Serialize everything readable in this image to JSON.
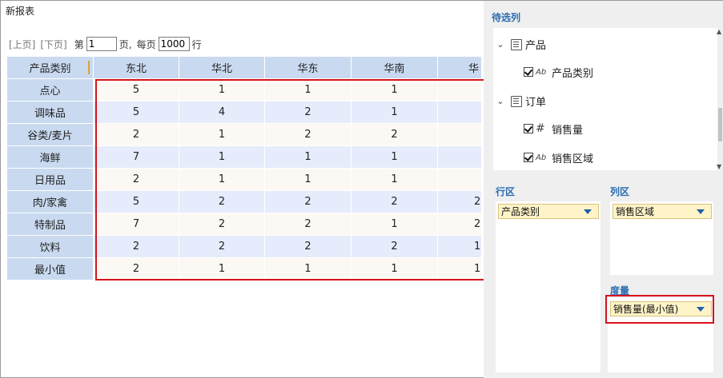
{
  "report": {
    "title": "新报表",
    "pager": {
      "prev": "[上页]",
      "next": "[下页]",
      "page_prefix": "第",
      "page_value": "1",
      "page_suffix": "页,",
      "size_prefix": "每页",
      "size_value": "1000",
      "size_suffix": "行"
    },
    "corner_header": "产品类别",
    "columns": [
      "东北",
      "华北",
      "华东",
      "华南",
      "华"
    ],
    "rows": [
      {
        "label": "点心",
        "values": [
          "5",
          "1",
          "1",
          "1",
          ""
        ]
      },
      {
        "label": "调味品",
        "values": [
          "5",
          "4",
          "2",
          "1",
          ""
        ]
      },
      {
        "label": "谷类/麦片",
        "values": [
          "2",
          "1",
          "2",
          "2",
          ""
        ]
      },
      {
        "label": "海鲜",
        "values": [
          "7",
          "1",
          "1",
          "1",
          ""
        ]
      },
      {
        "label": "日用品",
        "values": [
          "2",
          "1",
          "1",
          "1",
          ""
        ]
      },
      {
        "label": "肉/家禽",
        "values": [
          "5",
          "2",
          "2",
          "2",
          "2"
        ]
      },
      {
        "label": "特制品",
        "values": [
          "7",
          "2",
          "2",
          "1",
          "2"
        ]
      },
      {
        "label": "饮料",
        "values": [
          "2",
          "2",
          "2",
          "2",
          "1"
        ]
      },
      {
        "label": "最小值",
        "values": [
          "2",
          "1",
          "1",
          "1",
          "1"
        ]
      }
    ]
  },
  "panel": {
    "title": "待选列",
    "tree": {
      "group1": "产品",
      "field1": "产品类别",
      "field1_icon": "Ab",
      "group2": "订单",
      "field2": "销售量",
      "field2_icon": "#",
      "field3": "销售区域",
      "field3_icon": "Ab"
    },
    "row_zone": {
      "label": "行区",
      "chip": "产品类别"
    },
    "col_zone": {
      "label": "列区",
      "chip": "销售区域"
    },
    "measure_zone": {
      "label": "度量",
      "chip": "销售量(最小值)"
    },
    "colors": {
      "accent": "#2b6cb0",
      "highlight": "#d6141c",
      "chip_bg": "#fff4c8",
      "header_bg": "#c9daf0"
    }
  }
}
